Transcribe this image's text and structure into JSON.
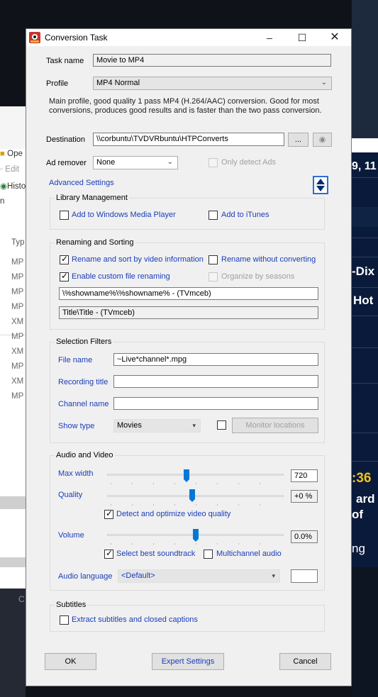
{
  "window": {
    "title": "Conversion Task"
  },
  "task": {
    "name_label": "Task name",
    "name_value": "Movie to MP4"
  },
  "profile": {
    "label": "Profile",
    "value": "MP4 Normal",
    "description_line1": "Main profile, good quality 1 pass MP4 (H.264/AAC) conversion. Good for most",
    "description_line2": "conversions, produces good results and is faster than the two pass conversion."
  },
  "destination": {
    "label": "Destination",
    "value": "\\\\corbuntu\\TVDVRbuntu\\HTPConverts",
    "browse_label": "..."
  },
  "ad_remover": {
    "label": "Ad remover",
    "value": "None",
    "only_detect_label": "Only detect Ads"
  },
  "advanced": {
    "label": "Advanced Settings"
  },
  "library": {
    "title": "Library Management",
    "wmp_label": "Add to Windows Media Player",
    "itunes_label": "Add to iTunes"
  },
  "renaming": {
    "title": "Renaming and Sorting",
    "rename_sort_label": "Rename and sort by video information",
    "rename_without_label": "Rename without converting",
    "custom_label": "Enable custom file renaming",
    "organize_label": "Organize by seasons",
    "pattern_value": "\\%showname%\\%showname%  - (TVmceb)",
    "preview_value": "Title\\Title  - (TVmceb)"
  },
  "filters": {
    "title": "Selection Filters",
    "file_name_label": "File name",
    "file_name_value": "~Live*channel*.mpg",
    "recording_title_label": "Recording title",
    "channel_name_label": "Channel name",
    "show_type_label": "Show type",
    "show_type_value": "Movies",
    "monitor_label": "Monitor locations"
  },
  "audio_video": {
    "title": "Audio and Video",
    "max_width_label": "Max width",
    "max_width_value": "720",
    "quality_label": "Quality",
    "quality_value": "+0 %",
    "detect_optimize_label": "Detect and optimize video quality",
    "volume_label": "Volume",
    "volume_value": "0.0%",
    "best_soundtrack_label": "Select best soundtrack",
    "multichannel_label": "Multichannel audio",
    "audio_language_label": "Audio language",
    "audio_language_value": "<Default>",
    "slider_levels": {
      "max_width": 0.45,
      "quality": 0.48,
      "volume": 0.5
    }
  },
  "subtitles": {
    "title": "Subtitles",
    "extract_label": "Extract subtitles and closed captions"
  },
  "buttons": {
    "ok": "OK",
    "expert": "Expert Settings",
    "cancel": "Cancel"
  },
  "background": {
    "left_items": [
      "Ope",
      "Edit",
      "Histo",
      "n",
      "Typ",
      "MP",
      "MP",
      "MP",
      "MP",
      "XM",
      "MP",
      "XM",
      "MP",
      "XM",
      "MP"
    ],
    "left_bottom": "C",
    "right_items": [
      "9, 11",
      "-Dix",
      "Hot",
      ":36",
      "ard",
      "of",
      "ng"
    ]
  },
  "colors": {
    "accent": "#0078d7",
    "link_blue": "#1a3dbb",
    "title_bar": "#ffffff"
  }
}
